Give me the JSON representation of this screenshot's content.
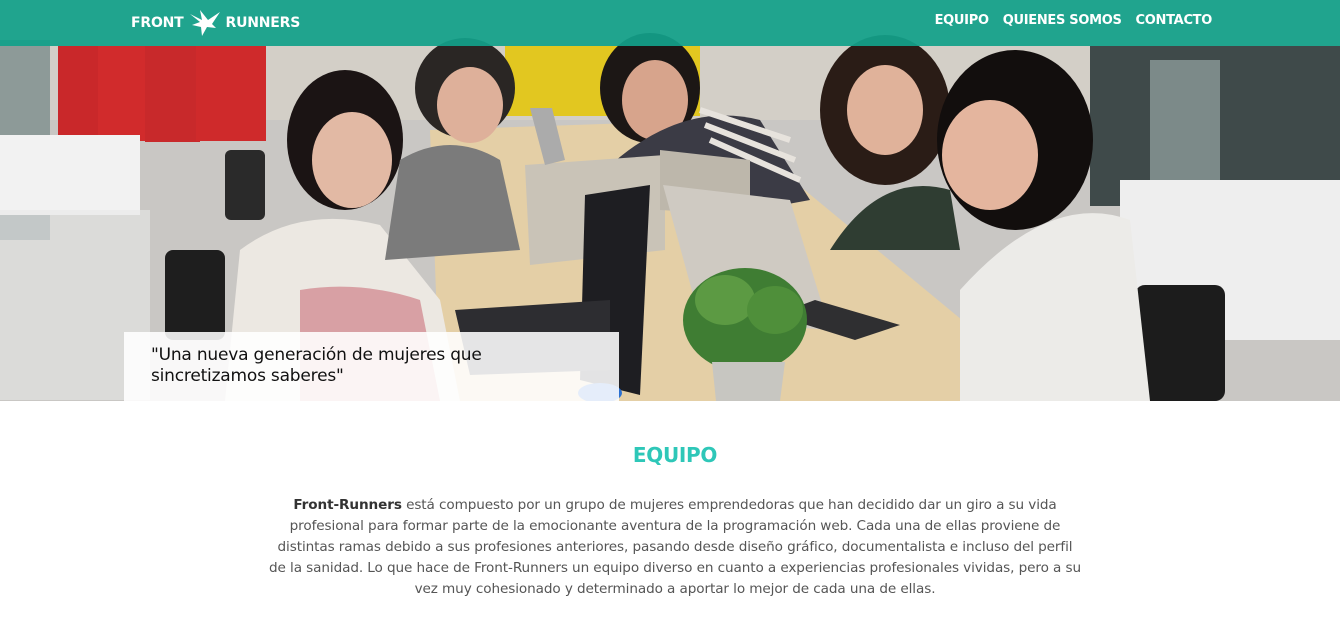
{
  "brand": {
    "left": "FRONT",
    "right": "RUNNERS",
    "icon": "bird-logo-icon"
  },
  "nav": {
    "items": [
      {
        "label": "EQUIPO"
      },
      {
        "label": "QUIENES SOMOS"
      },
      {
        "label": "CONTACTO"
      }
    ]
  },
  "hero": {
    "caption": "\"Una nueva generación de mujeres que sincretizamos saberes\""
  },
  "section": {
    "title": "EQUIPO",
    "lead": "Front-Runners",
    "body": " está compuesto por un grupo de mujeres emprendedoras que han decidido dar un giro a su vida profesional para formar parte de la emocionante aventura de la programación web. Cada una de ellas proviene de distintas ramas debido a sus profesiones anteriores, pasando desde diseño gráfico, documentalista e incluso del perfil de la sanidad. Lo que hace de Front-Runners un equipo diverso en cuanto a experiencias profesionales vividas, pero a su vez muy cohesionado y determinado a aportar lo mejor de cada una de ellas."
  },
  "colors": {
    "navbar": "#12a08a",
    "accent": "#2ec7b8",
    "text": "#555555"
  }
}
